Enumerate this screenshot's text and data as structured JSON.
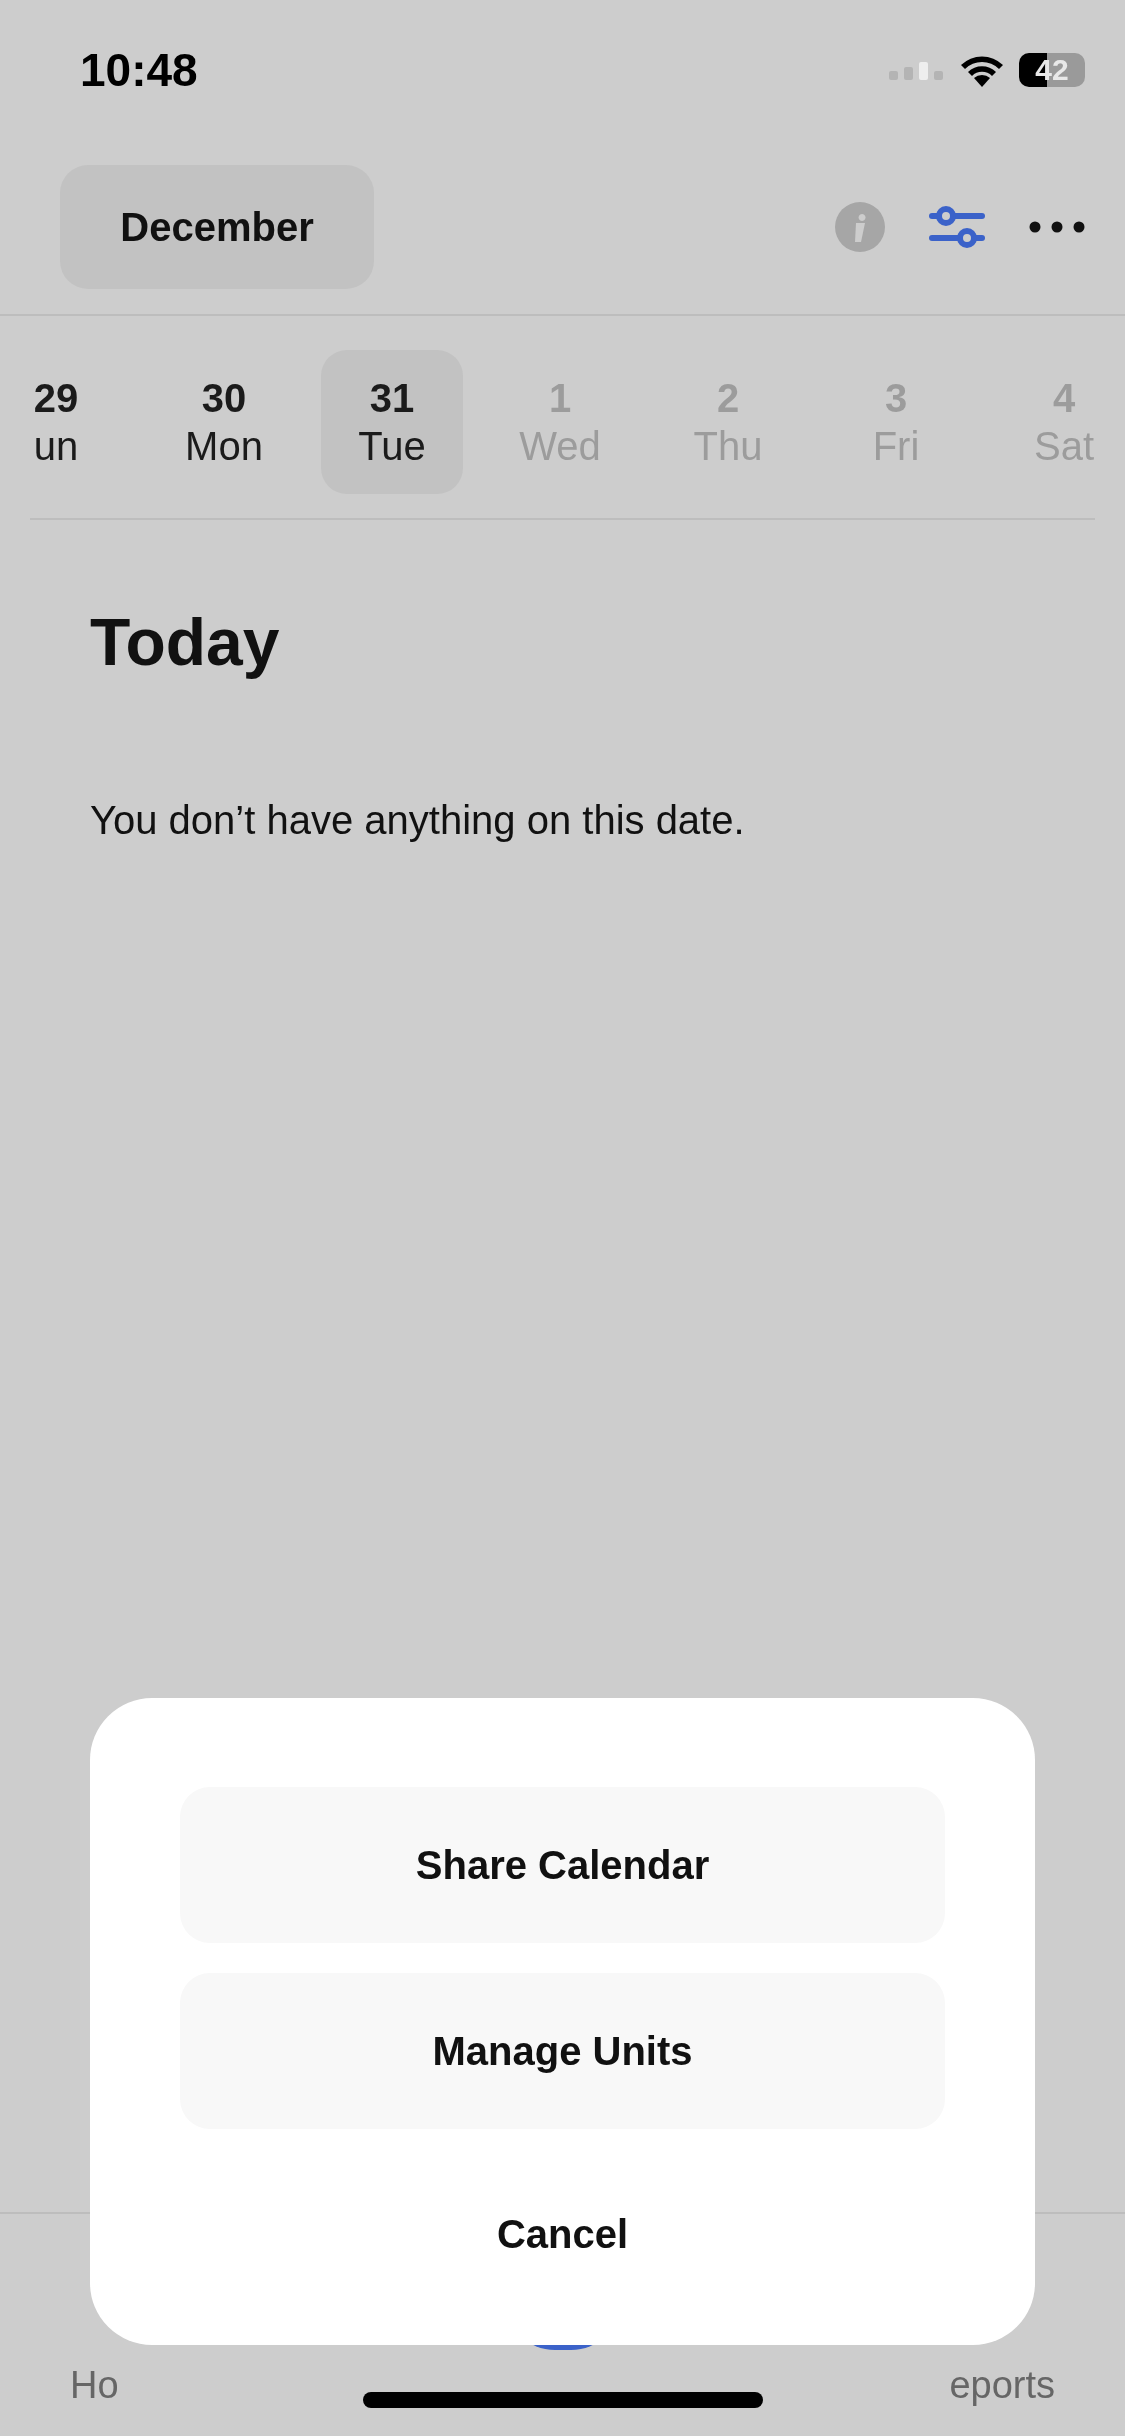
{
  "status_bar": {
    "time": "10:48",
    "battery": "42"
  },
  "header": {
    "month_button": "December"
  },
  "date_strip": [
    {
      "day": "29",
      "weekday": "un",
      "selected": false,
      "dimmed": false
    },
    {
      "day": "30",
      "weekday": "Mon",
      "selected": false,
      "dimmed": false
    },
    {
      "day": "31",
      "weekday": "Tue",
      "selected": true,
      "dimmed": false
    },
    {
      "day": "1",
      "weekday": "Wed",
      "selected": false,
      "dimmed": true
    },
    {
      "day": "2",
      "weekday": "Thu",
      "selected": false,
      "dimmed": true
    },
    {
      "day": "3",
      "weekday": "Fri",
      "selected": false,
      "dimmed": true
    },
    {
      "day": "4",
      "weekday": "Sat",
      "selected": false,
      "dimmed": true
    }
  ],
  "content": {
    "heading": "Today",
    "empty_message": "You don’t have anything on this date."
  },
  "tab_bar": {
    "left_label": "Ho",
    "right_label": "eports"
  },
  "action_sheet": {
    "actions": [
      "Share Calendar",
      "Manage Units"
    ],
    "cancel": "Cancel"
  }
}
